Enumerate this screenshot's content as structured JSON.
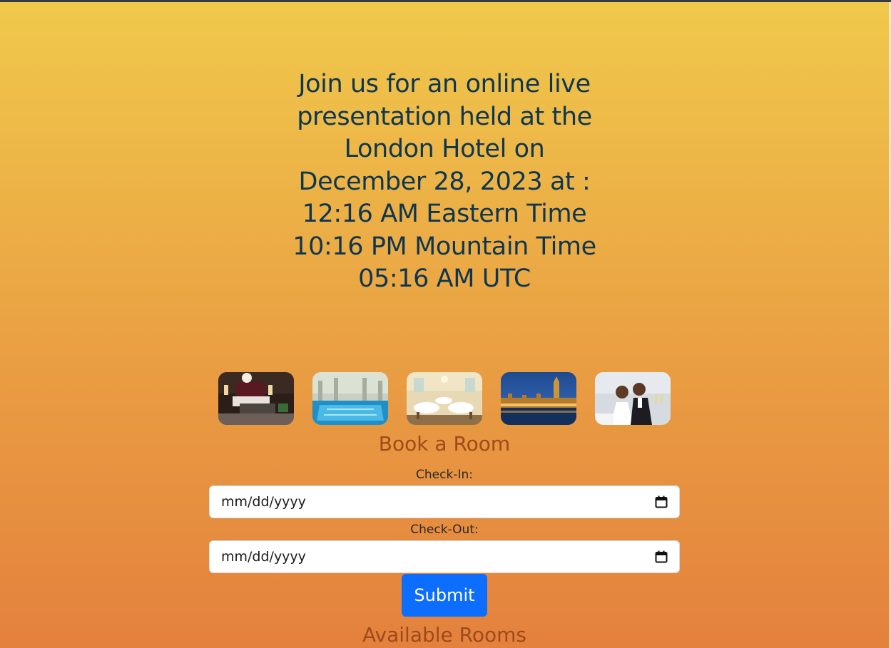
{
  "announcement": {
    "line1": "Join us for an online live",
    "line2": "presentation held at the",
    "line3": "London Hotel on",
    "line4": "December 28, 2023 at :",
    "line5": "12:16 AM Eastern Time",
    "line6": "10:16 PM Mountain Time",
    "line7": "05:16 AM UTC"
  },
  "gallery": {
    "images": [
      {
        "icon": "hotel-bedroom-photo"
      },
      {
        "icon": "indoor-pool-photo"
      },
      {
        "icon": "dining-room-photo"
      },
      {
        "icon": "london-parliament-night-photo"
      },
      {
        "icon": "wedding-couple-photo"
      }
    ]
  },
  "booking": {
    "heading": "Book a Room",
    "checkin_label": "Check-In:",
    "checkin_placeholder": "mm/dd/yyyy",
    "checkout_label": "Check-Out:",
    "checkout_placeholder": "mm/dd/yyyy",
    "submit_label": "Submit",
    "calendar_icon": "calendar-icon"
  },
  "available": {
    "heading": "Available Rooms"
  },
  "colors": {
    "accent": "#0d6efd",
    "heading_text": "#0f3650",
    "section_heading": "#9e4a1b",
    "gradient_top": "#f0c94b",
    "gradient_bottom": "#e4813d"
  }
}
